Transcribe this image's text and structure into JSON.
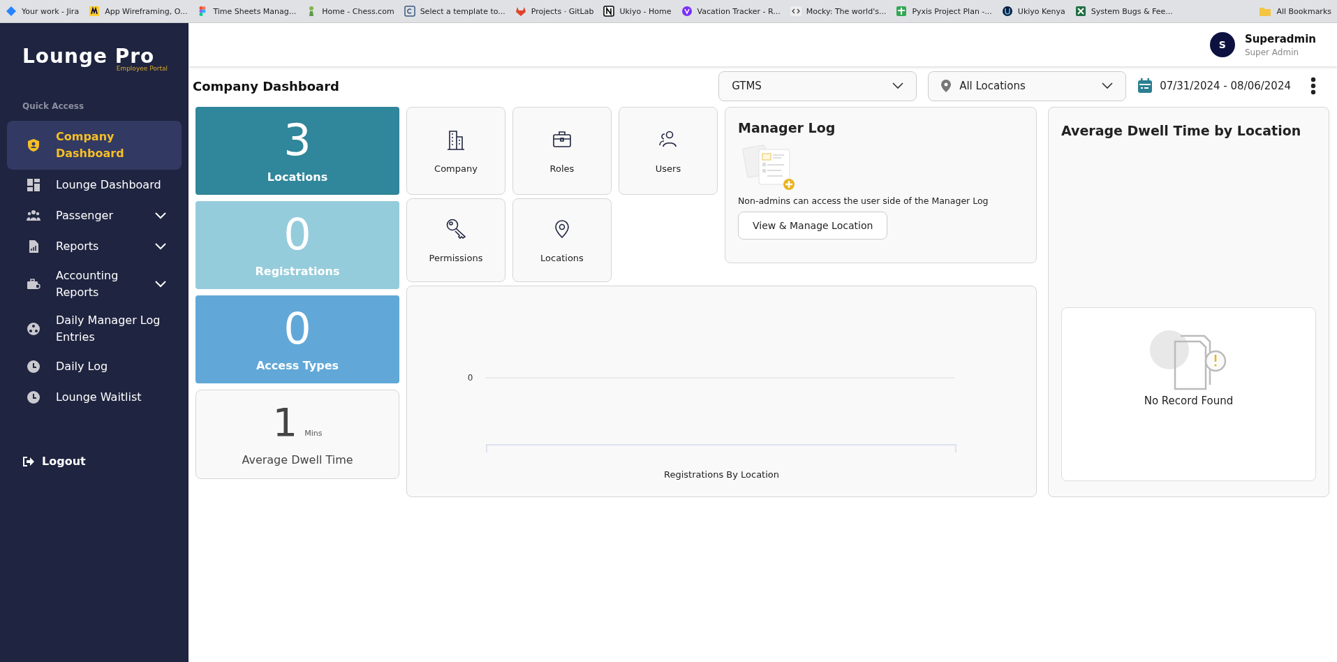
{
  "bookmarks": [
    {
      "label": "Your work - Jira"
    },
    {
      "label": "App Wireframing, O..."
    },
    {
      "label": "Time Sheets Manag..."
    },
    {
      "label": "Home - Chess.com"
    },
    {
      "label": "Select a template to..."
    },
    {
      "label": "Projects · GitLab"
    },
    {
      "label": "Ukiyo - Home"
    },
    {
      "label": "Vacation Tracker - R..."
    },
    {
      "label": "Mocky: The world's..."
    },
    {
      "label": "Pyxis Project Plan -..."
    },
    {
      "label": "Ukiyo Kenya"
    },
    {
      "label": "System Bugs & Fee..."
    }
  ],
  "all_bookmarks": "All Bookmarks",
  "sidebar": {
    "logo": "Lounge Pro",
    "logo_subtitle": "Employee Portal",
    "section": "Quick Access",
    "items": [
      {
        "label": "Company Dashboard",
        "selected": true,
        "expandable": false
      },
      {
        "label": "Lounge Dashboard",
        "selected": false,
        "expandable": false
      },
      {
        "label": "Passenger",
        "selected": false,
        "expandable": true
      },
      {
        "label": "Reports",
        "selected": false,
        "expandable": true
      },
      {
        "label": "Accounting Reports",
        "selected": false,
        "expandable": true
      },
      {
        "label": "Daily Manager Log Entries",
        "selected": false,
        "expandable": false
      },
      {
        "label": "Daily Log",
        "selected": false,
        "expandable": false
      },
      {
        "label": "Lounge Waitlist",
        "selected": false,
        "expandable": false
      }
    ],
    "logout": "Logout"
  },
  "user": {
    "initial": "S",
    "name": "Superadmin",
    "role": "Super Admin"
  },
  "page_title": "Company Dashboard",
  "filters": {
    "company": "GTMS",
    "location": "All Locations",
    "date_range": "07/31/2024 - 08/06/2024"
  },
  "stats": [
    {
      "kind": "count",
      "value": "3",
      "label": "Locations",
      "color": "#30869a"
    },
    {
      "kind": "count",
      "value": "0",
      "label": "Registrations",
      "color": "#95ccdb"
    },
    {
      "kind": "count",
      "value": "0",
      "label": "Access Types",
      "color": "#61a8d8"
    },
    {
      "kind": "duration",
      "value": "1",
      "unit": "Mins",
      "label": "Average Dwell Time"
    }
  ],
  "shortcuts": [
    {
      "label": "Company"
    },
    {
      "label": "Roles"
    },
    {
      "label": "Users"
    },
    {
      "label": "Permissions"
    },
    {
      "label": "Locations"
    }
  ],
  "manager_log": {
    "title": "Manager Log",
    "text": "Non-admins can access the user side of the Manager Log",
    "button": "View & Manage Location"
  },
  "registrations_chart": {
    "ytick": "0",
    "xlabel": "Registrations By Location"
  },
  "dwell_panel": {
    "title": "Average Dwell Time by Location",
    "empty_text": "No Record Found"
  }
}
